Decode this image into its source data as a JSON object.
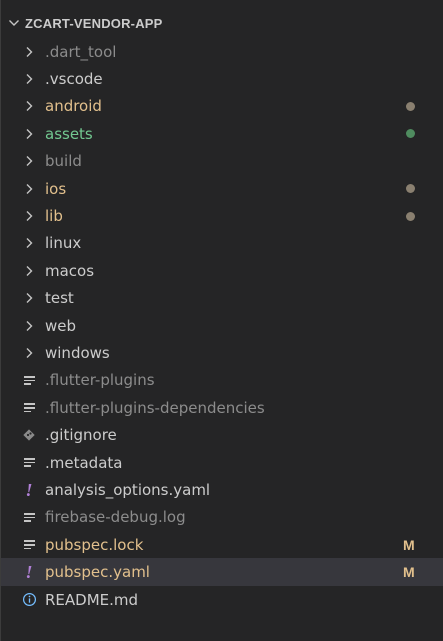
{
  "explorer": {
    "title": "ZCART-VENDOR-APP",
    "items": [
      {
        "label": ".dart_tool",
        "kind": "folder",
        "color": "#8c8c8c",
        "icon": "chevron-right-icon"
      },
      {
        "label": ".vscode",
        "kind": "folder",
        "color": "#cccccc",
        "icon": "chevron-right-icon"
      },
      {
        "label": "android",
        "kind": "folder",
        "color": "#e2c08d",
        "icon": "chevron-right-icon",
        "dot": "#8a8070"
      },
      {
        "label": "assets",
        "kind": "folder",
        "color": "#73c991",
        "icon": "chevron-right-icon",
        "dot": "#4f8c5f"
      },
      {
        "label": "build",
        "kind": "folder",
        "color": "#8c8c8c",
        "icon": "chevron-right-icon"
      },
      {
        "label": "ios",
        "kind": "folder",
        "color": "#e2c08d",
        "icon": "chevron-right-icon",
        "dot": "#8a8070"
      },
      {
        "label": "lib",
        "kind": "folder",
        "color": "#e2c08d",
        "icon": "chevron-right-icon",
        "dot": "#8a8070"
      },
      {
        "label": "linux",
        "kind": "folder",
        "color": "#cccccc",
        "icon": "chevron-right-icon"
      },
      {
        "label": "macos",
        "kind": "folder",
        "color": "#cccccc",
        "icon": "chevron-right-icon"
      },
      {
        "label": "test",
        "kind": "folder",
        "color": "#cccccc",
        "icon": "chevron-right-icon"
      },
      {
        "label": "web",
        "kind": "folder",
        "color": "#cccccc",
        "icon": "chevron-right-icon"
      },
      {
        "label": "windows",
        "kind": "folder",
        "color": "#cccccc",
        "icon": "chevron-right-icon"
      },
      {
        "label": ".flutter-plugins",
        "kind": "file",
        "color": "#8c8c8c",
        "icon": "lines-file-icon"
      },
      {
        "label": ".flutter-plugins-dependencies",
        "kind": "file",
        "color": "#8c8c8c",
        "icon": "lines-file-icon"
      },
      {
        "label": ".gitignore",
        "kind": "file",
        "color": "#cccccc",
        "icon": "git-diamond-icon"
      },
      {
        "label": ".metadata",
        "kind": "file",
        "color": "#cccccc",
        "icon": "lines-file-icon"
      },
      {
        "label": "analysis_options.yaml",
        "kind": "file",
        "color": "#cccccc",
        "icon": "yaml-exclamation-icon"
      },
      {
        "label": "firebase-debug.log",
        "kind": "file",
        "color": "#8c8c8c",
        "icon": "lines-file-icon"
      },
      {
        "label": "pubspec.lock",
        "kind": "file",
        "color": "#e2c08d",
        "icon": "lines-file-icon",
        "badge": "M"
      },
      {
        "label": "pubspec.yaml",
        "kind": "file",
        "color": "#e2c08d",
        "icon": "yaml-exclamation-icon",
        "badge": "M",
        "selected": true
      },
      {
        "label": "README.md",
        "kind": "file",
        "color": "#cccccc",
        "icon": "info-icon"
      }
    ]
  },
  "colors": {
    "background": "#252526",
    "selected_row": "#37373d",
    "modified": "#e2c08d",
    "untracked": "#73c991"
  }
}
